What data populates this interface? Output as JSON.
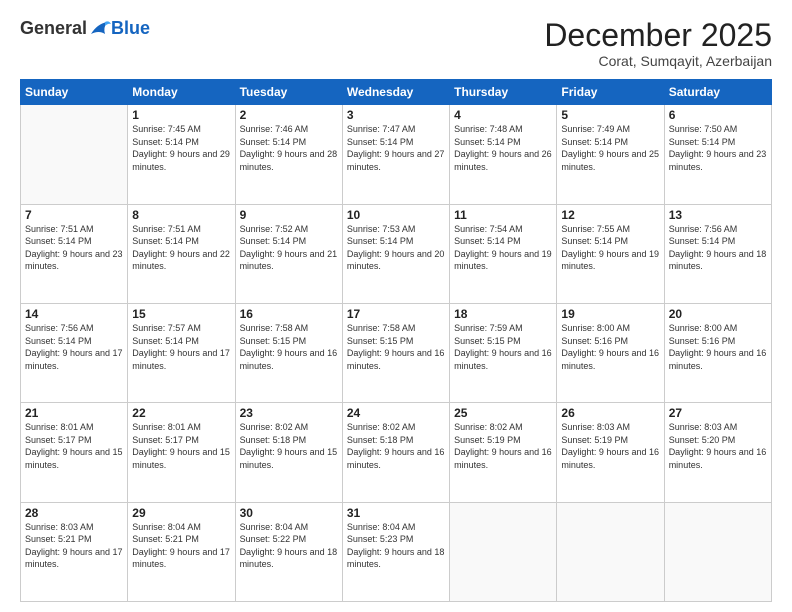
{
  "header": {
    "logo_general": "General",
    "logo_blue": "Blue",
    "month_title": "December 2025",
    "location": "Corat, Sumqayit, Azerbaijan"
  },
  "days_of_week": [
    "Sunday",
    "Monday",
    "Tuesday",
    "Wednesday",
    "Thursday",
    "Friday",
    "Saturday"
  ],
  "weeks": [
    [
      {
        "num": "",
        "sunrise": "",
        "sunset": "",
        "daylight": "",
        "empty": true
      },
      {
        "num": "1",
        "sunrise": "Sunrise: 7:45 AM",
        "sunset": "Sunset: 5:14 PM",
        "daylight": "Daylight: 9 hours and 29 minutes."
      },
      {
        "num": "2",
        "sunrise": "Sunrise: 7:46 AM",
        "sunset": "Sunset: 5:14 PM",
        "daylight": "Daylight: 9 hours and 28 minutes."
      },
      {
        "num": "3",
        "sunrise": "Sunrise: 7:47 AM",
        "sunset": "Sunset: 5:14 PM",
        "daylight": "Daylight: 9 hours and 27 minutes."
      },
      {
        "num": "4",
        "sunrise": "Sunrise: 7:48 AM",
        "sunset": "Sunset: 5:14 PM",
        "daylight": "Daylight: 9 hours and 26 minutes."
      },
      {
        "num": "5",
        "sunrise": "Sunrise: 7:49 AM",
        "sunset": "Sunset: 5:14 PM",
        "daylight": "Daylight: 9 hours and 25 minutes."
      },
      {
        "num": "6",
        "sunrise": "Sunrise: 7:50 AM",
        "sunset": "Sunset: 5:14 PM",
        "daylight": "Daylight: 9 hours and 23 minutes."
      }
    ],
    [
      {
        "num": "7",
        "sunrise": "Sunrise: 7:51 AM",
        "sunset": "Sunset: 5:14 PM",
        "daylight": "Daylight: 9 hours and 23 minutes."
      },
      {
        "num": "8",
        "sunrise": "Sunrise: 7:51 AM",
        "sunset": "Sunset: 5:14 PM",
        "daylight": "Daylight: 9 hours and 22 minutes."
      },
      {
        "num": "9",
        "sunrise": "Sunrise: 7:52 AM",
        "sunset": "Sunset: 5:14 PM",
        "daylight": "Daylight: 9 hours and 21 minutes."
      },
      {
        "num": "10",
        "sunrise": "Sunrise: 7:53 AM",
        "sunset": "Sunset: 5:14 PM",
        "daylight": "Daylight: 9 hours and 20 minutes."
      },
      {
        "num": "11",
        "sunrise": "Sunrise: 7:54 AM",
        "sunset": "Sunset: 5:14 PM",
        "daylight": "Daylight: 9 hours and 19 minutes."
      },
      {
        "num": "12",
        "sunrise": "Sunrise: 7:55 AM",
        "sunset": "Sunset: 5:14 PM",
        "daylight": "Daylight: 9 hours and 19 minutes."
      },
      {
        "num": "13",
        "sunrise": "Sunrise: 7:56 AM",
        "sunset": "Sunset: 5:14 PM",
        "daylight": "Daylight: 9 hours and 18 minutes."
      }
    ],
    [
      {
        "num": "14",
        "sunrise": "Sunrise: 7:56 AM",
        "sunset": "Sunset: 5:14 PM",
        "daylight": "Daylight: 9 hours and 17 minutes."
      },
      {
        "num": "15",
        "sunrise": "Sunrise: 7:57 AM",
        "sunset": "Sunset: 5:14 PM",
        "daylight": "Daylight: 9 hours and 17 minutes."
      },
      {
        "num": "16",
        "sunrise": "Sunrise: 7:58 AM",
        "sunset": "Sunset: 5:15 PM",
        "daylight": "Daylight: 9 hours and 16 minutes."
      },
      {
        "num": "17",
        "sunrise": "Sunrise: 7:58 AM",
        "sunset": "Sunset: 5:15 PM",
        "daylight": "Daylight: 9 hours and 16 minutes."
      },
      {
        "num": "18",
        "sunrise": "Sunrise: 7:59 AM",
        "sunset": "Sunset: 5:15 PM",
        "daylight": "Daylight: 9 hours and 16 minutes."
      },
      {
        "num": "19",
        "sunrise": "Sunrise: 8:00 AM",
        "sunset": "Sunset: 5:16 PM",
        "daylight": "Daylight: 9 hours and 16 minutes."
      },
      {
        "num": "20",
        "sunrise": "Sunrise: 8:00 AM",
        "sunset": "Sunset: 5:16 PM",
        "daylight": "Daylight: 9 hours and 16 minutes."
      }
    ],
    [
      {
        "num": "21",
        "sunrise": "Sunrise: 8:01 AM",
        "sunset": "Sunset: 5:17 PM",
        "daylight": "Daylight: 9 hours and 15 minutes."
      },
      {
        "num": "22",
        "sunrise": "Sunrise: 8:01 AM",
        "sunset": "Sunset: 5:17 PM",
        "daylight": "Daylight: 9 hours and 15 minutes."
      },
      {
        "num": "23",
        "sunrise": "Sunrise: 8:02 AM",
        "sunset": "Sunset: 5:18 PM",
        "daylight": "Daylight: 9 hours and 15 minutes."
      },
      {
        "num": "24",
        "sunrise": "Sunrise: 8:02 AM",
        "sunset": "Sunset: 5:18 PM",
        "daylight": "Daylight: 9 hours and 16 minutes."
      },
      {
        "num": "25",
        "sunrise": "Sunrise: 8:02 AM",
        "sunset": "Sunset: 5:19 PM",
        "daylight": "Daylight: 9 hours and 16 minutes."
      },
      {
        "num": "26",
        "sunrise": "Sunrise: 8:03 AM",
        "sunset": "Sunset: 5:19 PM",
        "daylight": "Daylight: 9 hours and 16 minutes."
      },
      {
        "num": "27",
        "sunrise": "Sunrise: 8:03 AM",
        "sunset": "Sunset: 5:20 PM",
        "daylight": "Daylight: 9 hours and 16 minutes."
      }
    ],
    [
      {
        "num": "28",
        "sunrise": "Sunrise: 8:03 AM",
        "sunset": "Sunset: 5:21 PM",
        "daylight": "Daylight: 9 hours and 17 minutes."
      },
      {
        "num": "29",
        "sunrise": "Sunrise: 8:04 AM",
        "sunset": "Sunset: 5:21 PM",
        "daylight": "Daylight: 9 hours and 17 minutes."
      },
      {
        "num": "30",
        "sunrise": "Sunrise: 8:04 AM",
        "sunset": "Sunset: 5:22 PM",
        "daylight": "Daylight: 9 hours and 18 minutes."
      },
      {
        "num": "31",
        "sunrise": "Sunrise: 8:04 AM",
        "sunset": "Sunset: 5:23 PM",
        "daylight": "Daylight: 9 hours and 18 minutes."
      },
      {
        "num": "",
        "sunrise": "",
        "sunset": "",
        "daylight": "",
        "empty": true
      },
      {
        "num": "",
        "sunrise": "",
        "sunset": "",
        "daylight": "",
        "empty": true
      },
      {
        "num": "",
        "sunrise": "",
        "sunset": "",
        "daylight": "",
        "empty": true
      }
    ]
  ]
}
